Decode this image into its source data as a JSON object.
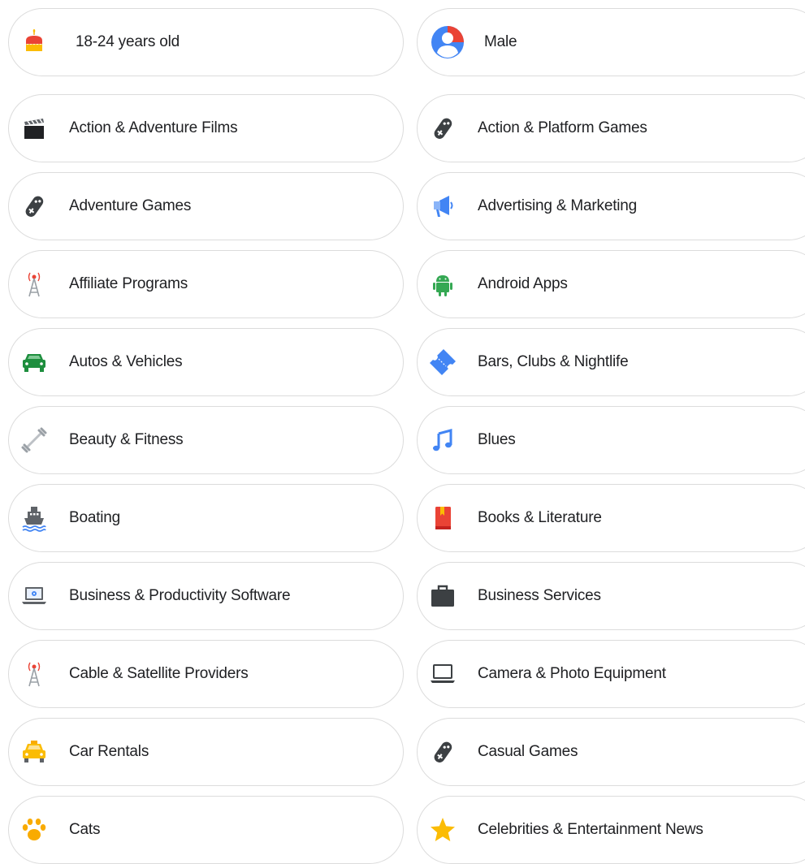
{
  "chips": [
    {
      "label": "18-24 years old",
      "icon": "birthday-cake-icon"
    },
    {
      "label": "Male",
      "icon": "person-avatar-icon"
    },
    {
      "label": "Action & Adventure Films",
      "icon": "clapperboard-icon"
    },
    {
      "label": "Action & Platform Games",
      "icon": "game-controller-icon"
    },
    {
      "label": "Adventure Games",
      "icon": "game-controller-icon"
    },
    {
      "label": "Advertising & Marketing",
      "icon": "megaphone-icon"
    },
    {
      "label": "Affiliate Programs",
      "icon": "radio-tower-icon"
    },
    {
      "label": "Android Apps",
      "icon": "android-icon"
    },
    {
      "label": "Autos & Vehicles",
      "icon": "car-icon"
    },
    {
      "label": "Bars, Clubs & Nightlife",
      "icon": "ticket-icon"
    },
    {
      "label": "Beauty & Fitness",
      "icon": "dumbbell-icon"
    },
    {
      "label": "Blues",
      "icon": "music-note-icon"
    },
    {
      "label": "Boating",
      "icon": "ship-icon"
    },
    {
      "label": "Books & Literature",
      "icon": "book-icon"
    },
    {
      "label": "Business & Productivity Software",
      "icon": "laptop-gear-icon"
    },
    {
      "label": "Business Services",
      "icon": "briefcase-icon"
    },
    {
      "label": "Cable & Satellite Providers",
      "icon": "radio-tower-icon"
    },
    {
      "label": "Camera & Photo Equipment",
      "icon": "laptop-icon"
    },
    {
      "label": "Car Rentals",
      "icon": "taxi-icon"
    },
    {
      "label": "Casual Games",
      "icon": "game-controller-icon"
    },
    {
      "label": "Cats",
      "icon": "paw-icon"
    },
    {
      "label": "Celebrities & Entertainment News",
      "icon": "star-icon"
    }
  ],
  "colors": {
    "chip_border": "#dcdcdc",
    "text": "#202124",
    "google_blue": "#4285f4",
    "google_red": "#ea4335",
    "google_yellow": "#fbbc04",
    "google_green": "#34a853",
    "dark_gray": "#3c4043"
  }
}
